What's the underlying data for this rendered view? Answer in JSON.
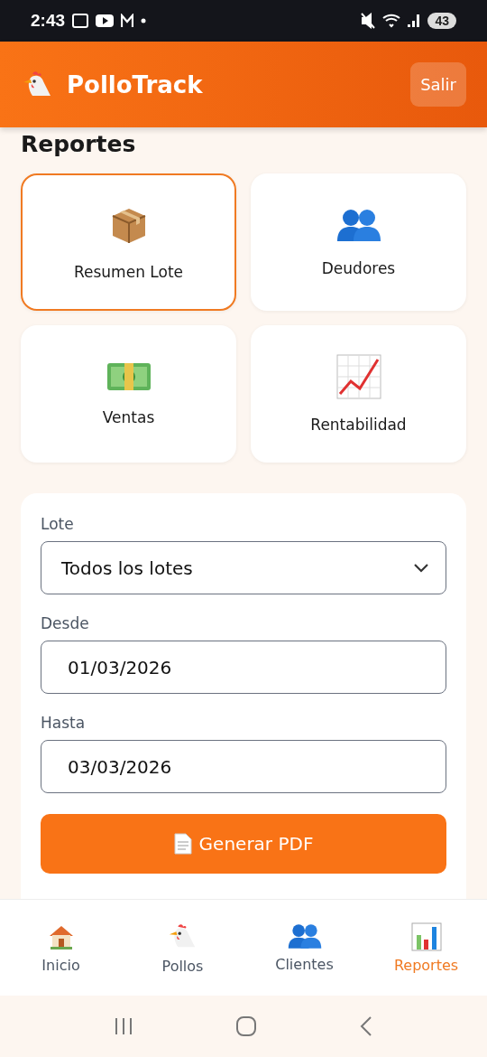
{
  "status_bar": {
    "time": "2:43",
    "battery": "43"
  },
  "header": {
    "title": "PolloTrack",
    "logout": "Salir"
  },
  "page_title": "Reportes",
  "report_cards": [
    {
      "label": "Resumen Lote",
      "selected": true
    },
    {
      "label": "Deudores",
      "selected": false
    },
    {
      "label": "Ventas",
      "selected": false
    },
    {
      "label": "Rentabilidad",
      "selected": false
    }
  ],
  "form": {
    "fields": [
      {
        "kind": "select",
        "label": "Lote",
        "value": "Todos los lotes"
      },
      {
        "kind": "date",
        "label": "Desde",
        "value": "01/03/2026"
      },
      {
        "kind": "date",
        "label": "Hasta",
        "value": "03/03/2026"
      }
    ],
    "generate_button": "Generar PDF"
  },
  "bottom_nav": [
    {
      "label": "Inicio",
      "selected": false
    },
    {
      "label": "Pollos",
      "selected": false
    },
    {
      "label": "Clientes",
      "selected": false
    },
    {
      "label": "Reportes",
      "selected": true
    }
  ]
}
